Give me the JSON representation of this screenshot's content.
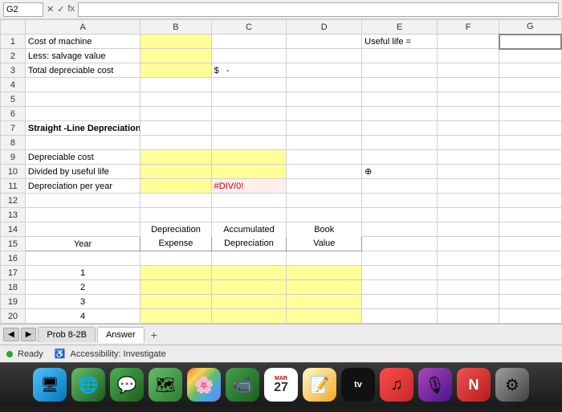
{
  "formula_bar": {
    "cell_ref": "G2",
    "formula_content": "fx"
  },
  "columns": [
    "",
    "A",
    "B",
    "C",
    "D",
    "E",
    "F",
    "G"
  ],
  "rows": [
    {
      "row_num": "1",
      "cells": {
        "a": "Cost of machine",
        "b": "",
        "c": "",
        "d": "",
        "e": "Useful life =",
        "f": "",
        "g": ""
      },
      "styles": {
        "a": "",
        "b": "yellow",
        "c": "",
        "d": "",
        "e": "",
        "f": "",
        "g": "bordered"
      }
    },
    {
      "row_num": "2",
      "cells": {
        "a": "Less: salvage value",
        "b": "",
        "c": "",
        "d": "",
        "e": "",
        "f": "",
        "g": ""
      },
      "styles": {
        "b": "yellow"
      }
    },
    {
      "row_num": "3",
      "cells": {
        "a": "Total depreciable cost",
        "b": "",
        "c": "$ -",
        "d": "",
        "e": "",
        "f": "",
        "g": ""
      },
      "styles": {
        "b": "yellow"
      }
    },
    {
      "row_num": "4",
      "cells": {}
    },
    {
      "row_num": "5",
      "cells": {}
    },
    {
      "row_num": "6",
      "cells": {}
    },
    {
      "row_num": "7",
      "cells": {
        "a": "Straight -Line Depreciation"
      },
      "styles": {
        "a": "bold"
      }
    },
    {
      "row_num": "8",
      "cells": {}
    },
    {
      "row_num": "9",
      "cells": {
        "a": "Depreciable cost",
        "b": "",
        "c": ""
      },
      "styles": {
        "b": "yellow",
        "c": "yellow"
      }
    },
    {
      "row_num": "10",
      "cells": {
        "a": "Divided by useful life",
        "b": "",
        "c": ""
      },
      "styles": {
        "b": "yellow",
        "c": "yellow"
      }
    },
    {
      "row_num": "11",
      "cells": {
        "a": "Depreciation per year",
        "b": "",
        "c": "#DIV/0!"
      },
      "styles": {
        "b": "yellow",
        "c": "error"
      }
    },
    {
      "row_num": "12",
      "cells": {}
    },
    {
      "row_num": "13",
      "cells": {}
    },
    {
      "row_num": "14",
      "cells": {
        "a": "",
        "b": "Depreciation",
        "c": "Accumulated",
        "d": "Book",
        "e": "",
        "f": "",
        "g": ""
      }
    },
    {
      "row_num": "15",
      "cells": {
        "a": "Year",
        "b": "Expense",
        "c": "Depreciation",
        "d": "Value",
        "e": "",
        "f": "",
        "g": ""
      }
    },
    {
      "row_num": "16",
      "cells": {}
    },
    {
      "row_num": "17",
      "cells": {
        "a": "1",
        "b": "",
        "c": "",
        "d": ""
      },
      "styles": {
        "b": "yellow",
        "c": "yellow",
        "d": "yellow"
      }
    },
    {
      "row_num": "18",
      "cells": {
        "a": "2",
        "b": "",
        "c": "",
        "d": ""
      },
      "styles": {
        "b": "yellow",
        "c": "yellow",
        "d": "yellow"
      }
    },
    {
      "row_num": "19",
      "cells": {
        "a": "3",
        "b": "",
        "c": "",
        "d": ""
      },
      "styles": {
        "b": "yellow",
        "c": "yellow",
        "d": "yellow"
      }
    },
    {
      "row_num": "20",
      "cells": {
        "a": "4",
        "b": "",
        "c": "",
        "d": ""
      },
      "styles": {
        "b": "yellow",
        "c": "yellow",
        "d": "yellow"
      }
    }
  ],
  "tabs": [
    {
      "label": "Prob 8-2B",
      "active": false
    },
    {
      "label": "Answer",
      "active": true
    }
  ],
  "tab_add_label": "+",
  "status": {
    "ready": "Ready",
    "accessibility": "Accessibility: Investigate"
  },
  "dock": {
    "date_label": "MAR",
    "date_number": "27",
    "items": [
      {
        "name": "finder",
        "label": "🖥"
      },
      {
        "name": "browser",
        "label": "🌐"
      },
      {
        "name": "messages",
        "label": "💬"
      },
      {
        "name": "maps",
        "label": "🗺"
      },
      {
        "name": "photos",
        "label": "🌸"
      },
      {
        "name": "facetime",
        "label": "📹"
      },
      {
        "name": "calendar",
        "label": "cal"
      },
      {
        "name": "notes",
        "label": "📝"
      },
      {
        "name": "appletv",
        "label": "tv"
      },
      {
        "name": "music",
        "label": "♫"
      },
      {
        "name": "podcasts",
        "label": "🎙"
      },
      {
        "name": "news",
        "label": "N"
      },
      {
        "name": "settings",
        "label": "⚙"
      }
    ]
  }
}
